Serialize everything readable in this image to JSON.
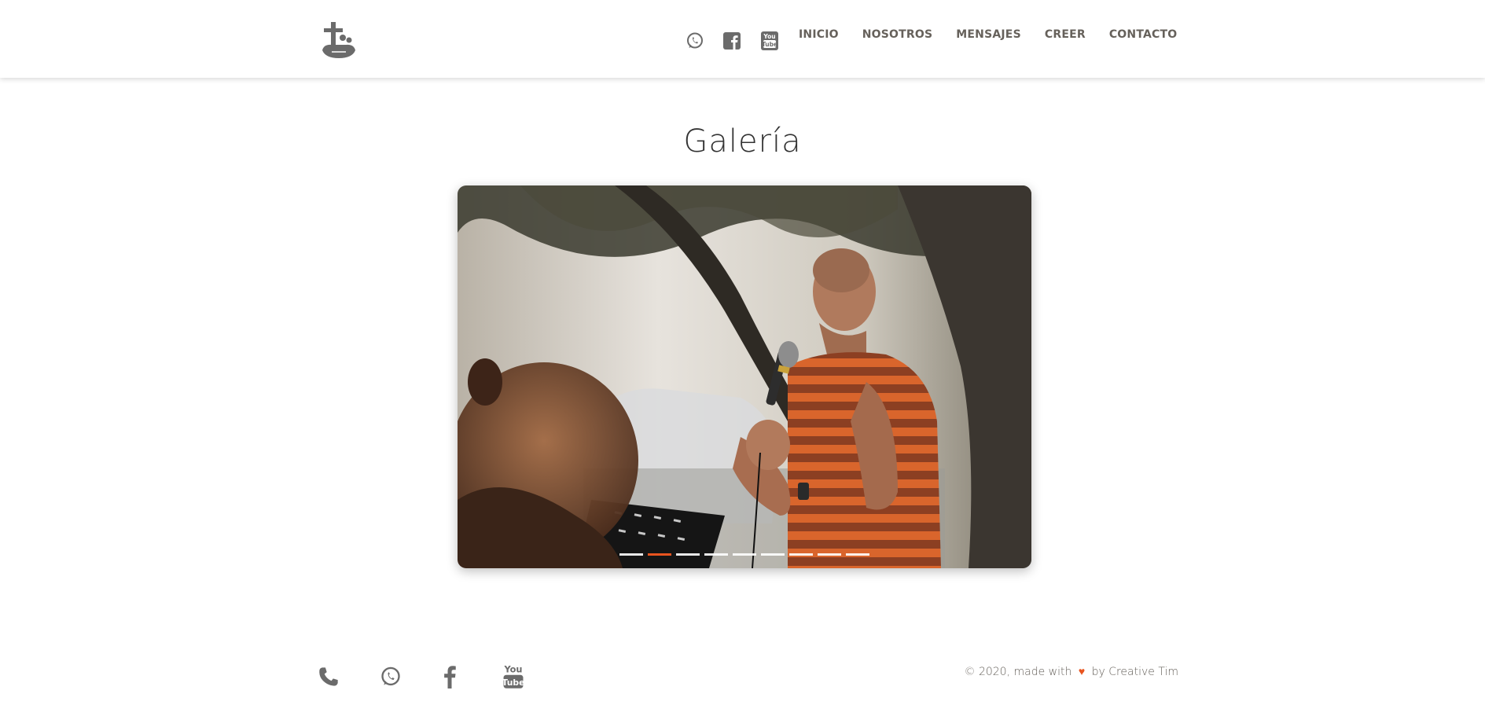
{
  "navbar": {
    "brand_icon": "cross-family-logo-icon",
    "social": [
      {
        "icon": "whatsapp-icon"
      },
      {
        "icon": "facebook-icon"
      },
      {
        "icon": "youtube-icon"
      }
    ],
    "links": [
      "INICIO",
      "NOSOTROS",
      "MENSAJES",
      "CREER",
      "CONTACTO"
    ]
  },
  "main": {
    "title": "Galería",
    "carousel": {
      "slide_count": 9,
      "active_index": 1
    }
  },
  "footer": {
    "icons": [
      "phone-icon",
      "whatsapp-icon",
      "facebook-icon",
      "youtube-icon"
    ],
    "credits_prefix": "© 2020, made with",
    "heart": "♥",
    "credits_suffix": "by Creative Tim"
  },
  "colors": {
    "accent": "#e8541f",
    "nav_text": "#66615b",
    "icon_gray": "#6b6b6b"
  }
}
